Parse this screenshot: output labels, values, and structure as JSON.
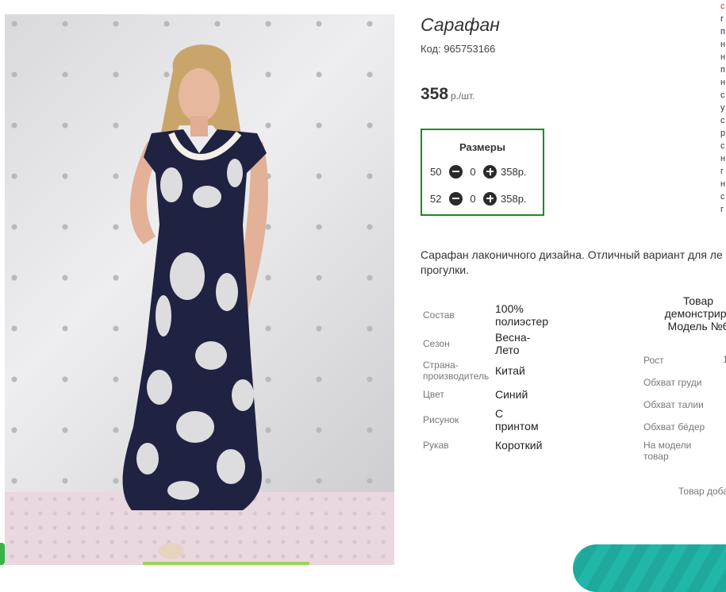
{
  "product": {
    "title": "Сарафан",
    "code_label": "Код: 965753166",
    "price": "358",
    "price_unit": "р./шт."
  },
  "sizes": {
    "heading": "Размеры",
    "rows": [
      {
        "size": "50",
        "qty": "0",
        "price": "358р."
      },
      {
        "size": "52",
        "qty": "0",
        "price": "358р."
      }
    ]
  },
  "description": {
    "line1": "Сарафан лаконичного дизайна. Отличный вариант для ле",
    "line2": "прогулки."
  },
  "attributes": [
    {
      "label": "Состав",
      "value1": "100%",
      "value2": "полиэстер"
    },
    {
      "label": "Сезон",
      "value1": "Весна-",
      "value2": "Лето"
    },
    {
      "label1": "Страна-",
      "label2": "производитель",
      "value1": "Китай"
    },
    {
      "label": "Цвет",
      "value1": "Синий"
    },
    {
      "label": "Рисунок",
      "value1": "С",
      "value2": "принтом"
    },
    {
      "label": "Рукав",
      "value1": "Короткий"
    }
  ],
  "model": {
    "head_line1": "Товар",
    "head_line2": "демонстриру",
    "head_line3": "Модель №6",
    "labels": [
      "Рост",
      "Обхват груди",
      "Обхват талии",
      "Обхват бёдер",
      "На модели",
      "товар"
    ],
    "value_fragment": "1"
  },
  "added_text": "Товар доба",
  "side_strip_chars": [
    "с",
    "г",
    "п",
    "н",
    "н",
    "п",
    "н",
    "с",
    "у",
    "с",
    "р",
    "с",
    "н",
    "г",
    "н",
    "с",
    "г"
  ],
  "colors": {
    "sizes_border": "#1e8a22",
    "teal_button": "#22b6a8",
    "side_first_char": "#e03030",
    "side_link_chars": "#1a1aa0"
  }
}
